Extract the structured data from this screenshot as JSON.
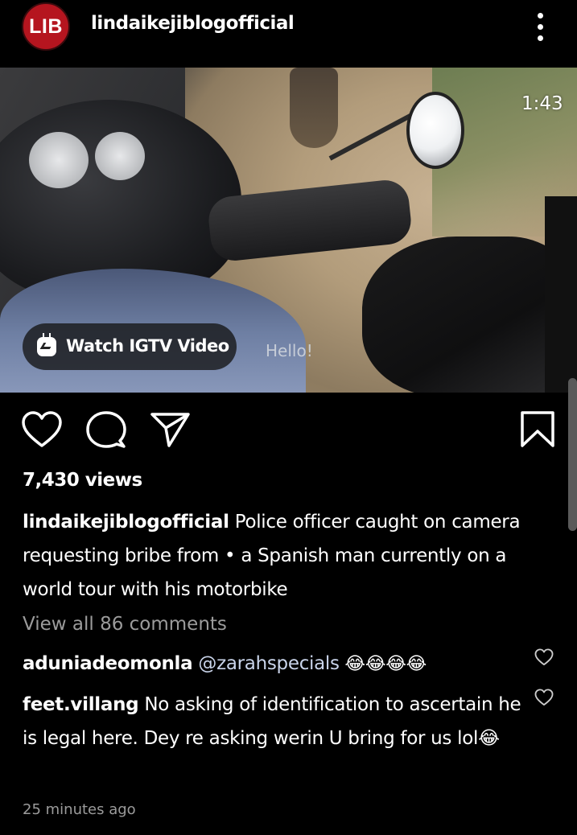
{
  "header": {
    "avatar_text": "LIB",
    "username": "lindaikejiblogofficial",
    "more_icon": "more-vertical-icon"
  },
  "video": {
    "duration": "1:43",
    "subtitle": "Hello!",
    "igtv_label": "Watch IGTV Video"
  },
  "actions": {
    "like_icon": "heart-outline-icon",
    "comment_icon": "comment-bubble-icon",
    "share_icon": "paper-plane-icon",
    "save_icon": "bookmark-icon"
  },
  "post": {
    "views": "7,430 views",
    "caption_user": "lindaikejiblogofficial",
    "caption_text": " Police officer caught on camera requesting bribe from • a Spanish man currently on a world tour with his motorbike",
    "view_all_comments": "View all 86 comments",
    "timestamp": "25 minutes ago"
  },
  "comments": [
    {
      "user": "aduniadeomonla",
      "mention": "@zarahspecials",
      "text": " 😂😂😂😂"
    },
    {
      "user": "feet.villang",
      "text": " No asking of identification to ascertain he is legal here. Dey re asking werin U bring for us lol😂"
    }
  ],
  "colors": {
    "background": "#000000",
    "avatar_red": "#b5151f",
    "muted_text": "#9b9b9b"
  }
}
